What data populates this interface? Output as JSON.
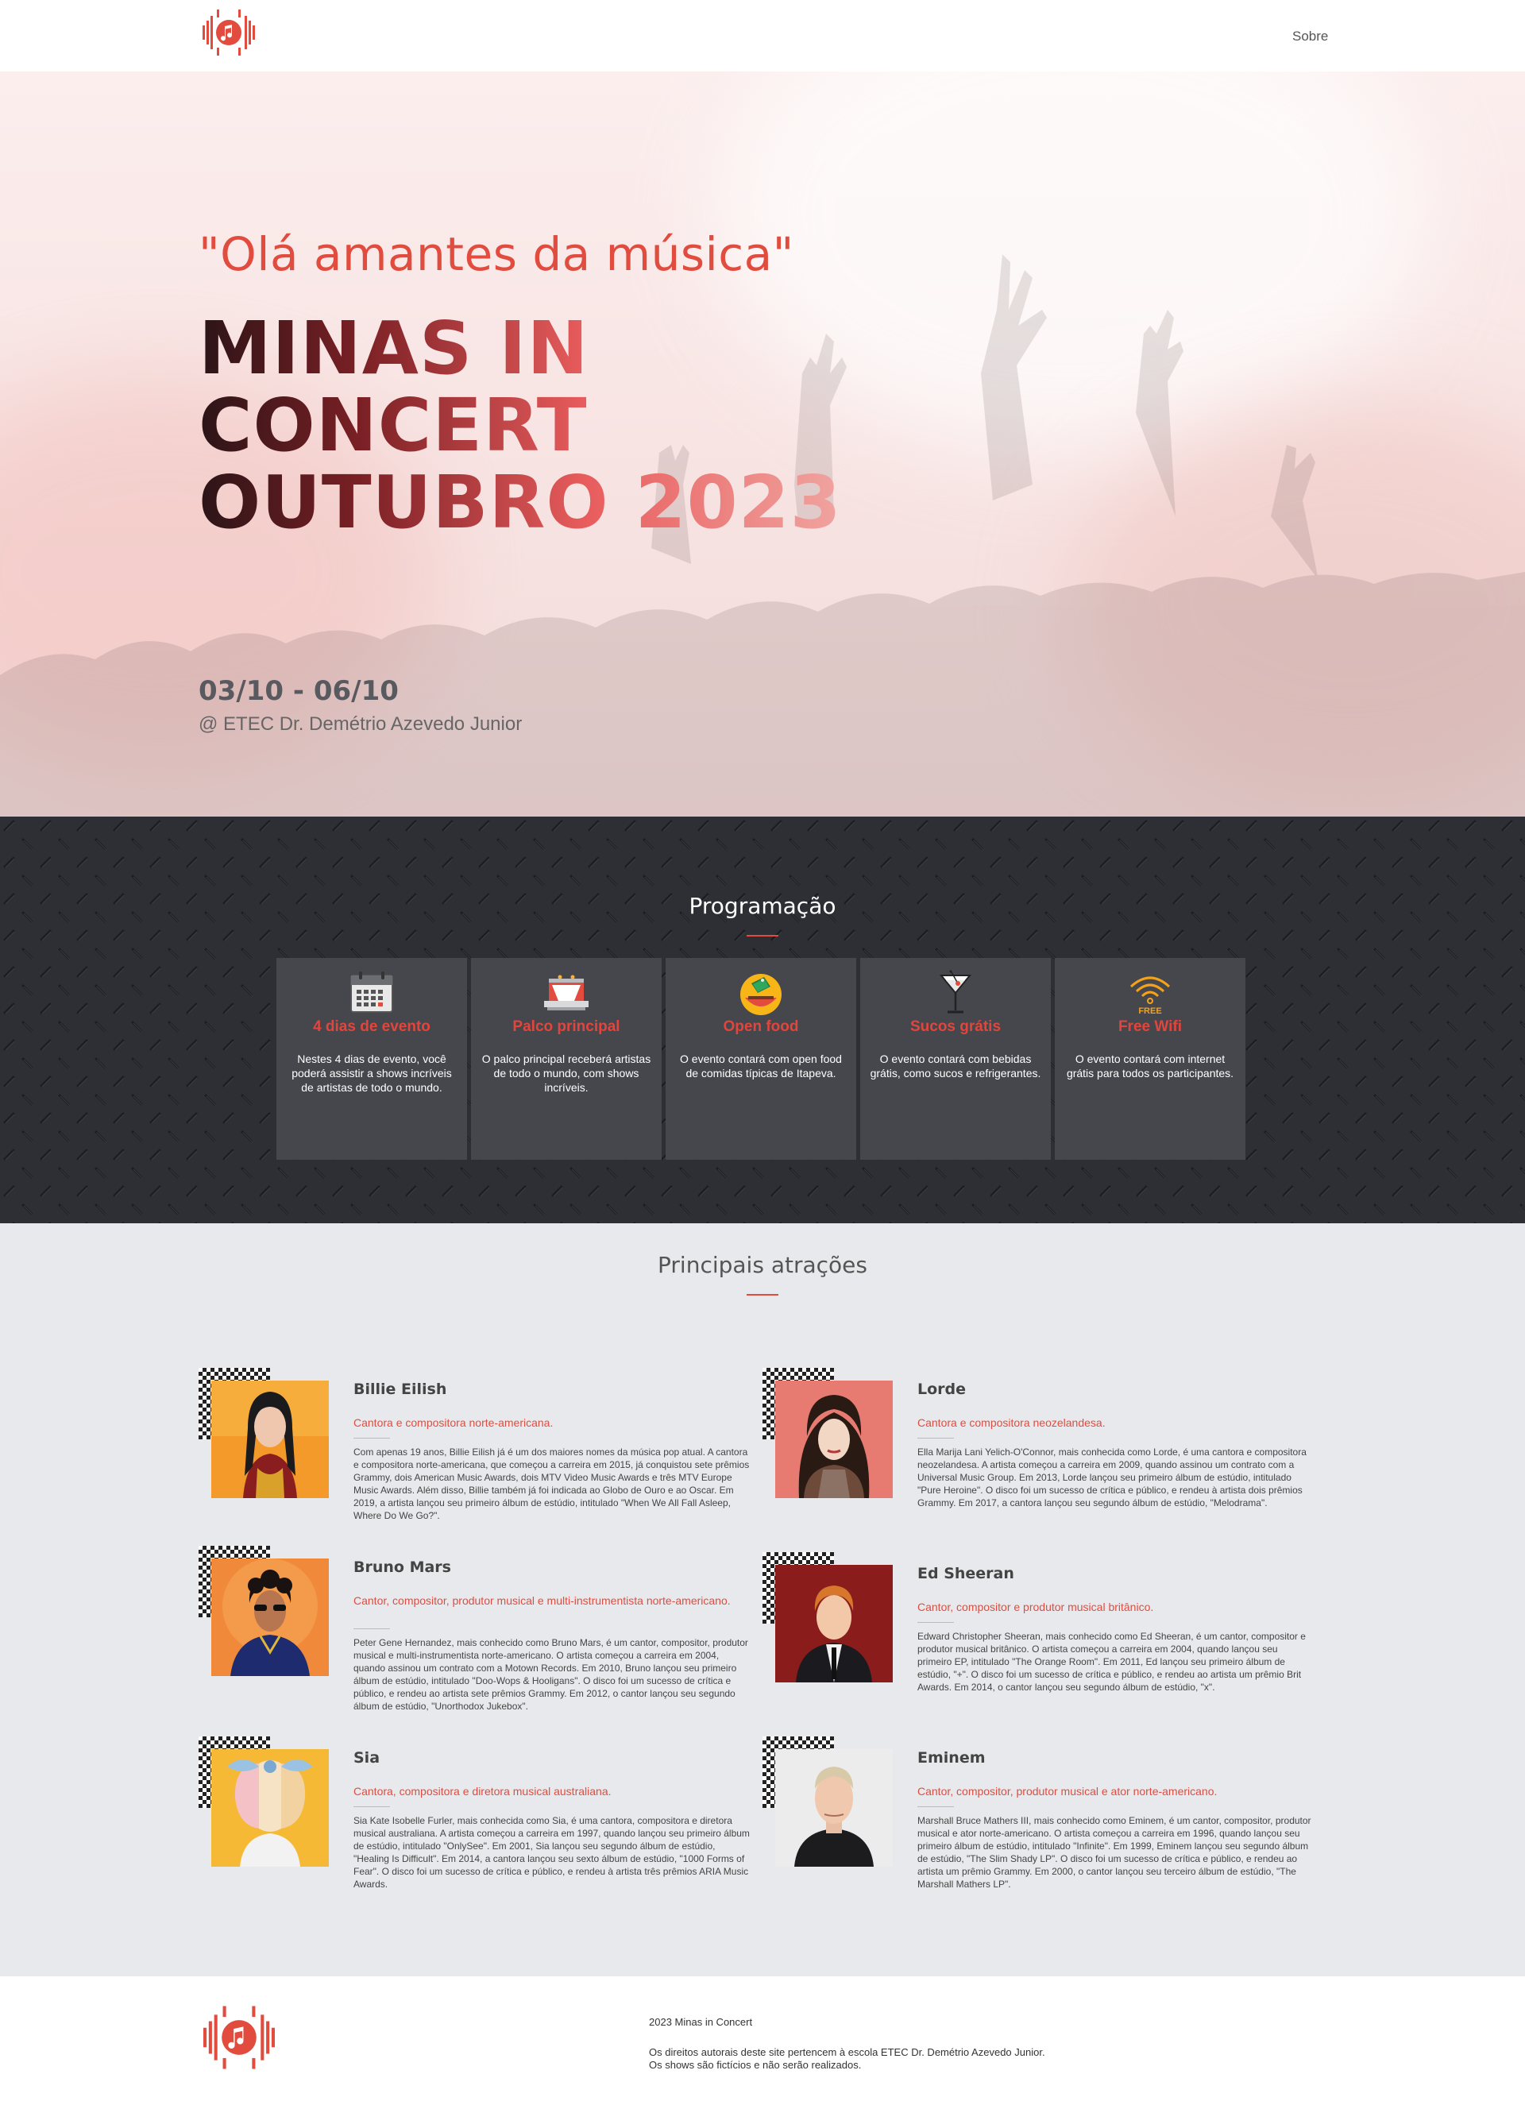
{
  "nav": {
    "sobre_label": "Sobre",
    "logo_icon": "music-note-logo-icon"
  },
  "hero": {
    "quote": "\"Olá amantes da música\"",
    "title_lines": [
      "MINAS IN",
      "CONCERT",
      "OUTUBRO 2023"
    ],
    "dates": "03/10 - 06/10",
    "venue": "@ ETEC Dr. Demétrio Azevedo Junior"
  },
  "programacao": {
    "heading": "Programação",
    "cards": [
      {
        "icon": "calendar-icon",
        "title": "4 dias de evento",
        "desc": "Nestes 4 dias de evento, você poderá assistir a shows incríveis de artistas de todo o mundo."
      },
      {
        "icon": "stage-icon",
        "title": "Palco principal",
        "desc": "O palco principal receberá artistas de todo o mundo, com shows incríveis."
      },
      {
        "icon": "food-icon",
        "title": "Open food",
        "desc": "O evento contará com open food de comidas típicas de Itapeva."
      },
      {
        "icon": "cocktail-icon",
        "title": "Sucos grátis",
        "desc": "O evento contará com bebidas grátis, como sucos e refrigerantes."
      },
      {
        "icon": "wifi-icon",
        "title": "Free Wifi",
        "desc": "O evento contará com internet grátis para todos os participantes.",
        "badge": "FREE"
      }
    ]
  },
  "atracoes": {
    "heading": "Principais atrações",
    "artists": [
      {
        "name": "Billie Eilish",
        "role": "Cantora e compositora norte-americana.",
        "bio": "Com apenas 19 anos, Billie Eilish já é um dos maiores nomes da música pop atual. A cantora e compositora norte-americana, que começou a carreira em 2015, já conquistou sete prêmios Grammy, dois American Music Awards, dois MTV Video Music Awards e três MTV Europe Music Awards. Além disso, Billie também já foi indicada ao Globo de Ouro e ao Oscar. Em 2019, a artista lançou seu primeiro álbum de estúdio, intitulado \"When We All Fall Asleep, Where Do We Go?\"."
      },
      {
        "name": "Lorde",
        "role": "Cantora e compositora neozelandesa.",
        "bio": "Ella Marija Lani Yelich-O'Connor, mais conhecida como Lorde, é uma cantora e compositora neozelandesa. A artista começou a carreira em 2009, quando assinou um contrato com a Universal Music Group. Em 2013, Lorde lançou seu primeiro álbum de estúdio, intitulado \"Pure Heroine\". O disco foi um sucesso de crítica e público, e rendeu à artista dois prêmios Grammy. Em 2017, a cantora lançou seu segundo álbum de estúdio, \"Melodrama\"."
      },
      {
        "name": "Bruno Mars",
        "role": "Cantor, compositor, produtor musical e multi-instrumentista norte-americano.",
        "bio": "Peter Gene Hernandez, mais conhecido como Bruno Mars, é um cantor, compositor, produtor musical e multi-instrumentista norte-americano. O artista começou a carreira em 2004, quando assinou um contrato com a Motown Records. Em 2010, Bruno lançou seu primeiro álbum de estúdio, intitulado \"Doo-Wops & Hooligans\". O disco foi um sucesso de crítica e público, e rendeu ao artista sete prêmios Grammy. Em 2012, o cantor lançou seu segundo álbum de estúdio, \"Unorthodox Jukebox\"."
      },
      {
        "name": "Ed Sheeran",
        "role": "Cantor, compositor e produtor musical britânico.",
        "bio": "Edward Christopher Sheeran, mais conhecido como Ed Sheeran, é um cantor, compositor e produtor musical britânico. O artista começou a carreira em 2004, quando lançou seu primeiro EP, intitulado \"The Orange Room\". Em 2011, Ed lançou seu primeiro álbum de estúdio, \"+\". O disco foi um sucesso de crítica e público, e rendeu ao artista um prêmio Brit Awards. Em 2014, o cantor lançou seu segundo álbum de estúdio, \"x\"."
      },
      {
        "name": "Sia",
        "role": "Cantora, compositora e diretora musical australiana.",
        "bio": "Sia Kate Isobelle Furler, mais conhecida como Sia, é uma cantora, compositora e diretora musical australiana. A artista começou a carreira em 1997, quando lançou seu primeiro álbum de estúdio, intitulado \"OnlySee\". Em 2001, Sia lançou seu segundo álbum de estúdio, \"Healing Is Difficult\". Em 2014, a cantora lançou seu sexto álbum de estúdio, \"1000 Forms of Fear\". O disco foi um sucesso de crítica e público, e rendeu à artista três prêmios ARIA Music Awards."
      },
      {
        "name": "Eminem",
        "role": "Cantor, compositor, produtor musical e ator norte-americano.",
        "bio": "Marshall Bruce Mathers III, mais conhecido como Eminem, é um cantor, compositor, produtor musical e ator norte-americano. O artista começou a carreira em 1996, quando lançou seu primeiro álbum de estúdio, intitulado \"Infinite\". Em 1999, Eminem lançou seu segundo álbum de estúdio, \"The Slim Shady LP\". O disco foi um sucesso de crítica e público, e rendeu ao artista um prêmio Grammy. Em 2000, o cantor lançou seu terceiro álbum de estúdio, \"The Marshall Mathers LP\"."
      }
    ]
  },
  "footer": {
    "copy": "2023 Minas in Concert",
    "rights_1": "Os direitos autorais deste site pertencem à escola ETEC Dr. Demétrio Azevedo Junior.",
    "rights_2": "Os shows são fictícios e não serão realizados."
  },
  "colors": {
    "accent": "#e14c3f",
    "dark": "#2d2f35",
    "card": "#45474d",
    "page_bg": "#e8e9ec"
  }
}
